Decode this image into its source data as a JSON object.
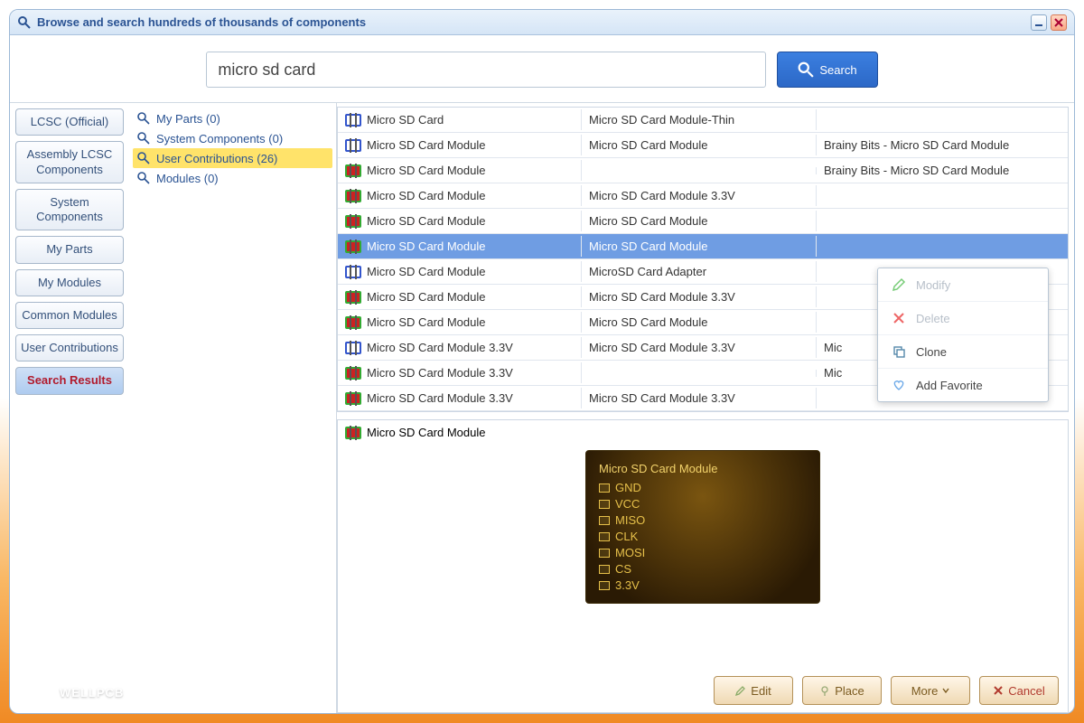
{
  "window": {
    "title": "Browse and search hundreds of thousands of components"
  },
  "search": {
    "value": "micro sd card",
    "button": "Search"
  },
  "nav": {
    "items": [
      "LCSC (Official)",
      "Assembly LCSC Components",
      "System Components",
      "My Parts",
      "My Modules",
      "Common Modules",
      "User Contributions",
      "Search Results"
    ],
    "activeIndex": 7
  },
  "tree": {
    "items": [
      {
        "label": "My Parts (0)"
      },
      {
        "label": "System Components (0)"
      },
      {
        "label": "User Contributions (26)"
      },
      {
        "label": "Modules (0)"
      }
    ],
    "selectedIndex": 2
  },
  "table": {
    "rows": [
      {
        "icon": "blue",
        "c1": "Micro SD Card",
        "c2": "Micro SD Card Module-Thin",
        "c3": ""
      },
      {
        "icon": "blue",
        "c1": "Micro SD Card Module",
        "c2": "Micro SD Card Module",
        "c3": "Brainy Bits - Micro SD Card Module"
      },
      {
        "icon": "green",
        "c1": "Micro SD Card Module",
        "c2": "",
        "c3": "Brainy Bits - Micro SD Card Module"
      },
      {
        "icon": "green",
        "c1": "Micro SD Card Module",
        "c2": "Micro SD Card Module 3.3V",
        "c3": ""
      },
      {
        "icon": "green",
        "c1": "Micro SD Card Module",
        "c2": "Micro SD Card Module",
        "c3": ""
      },
      {
        "icon": "green",
        "c1": "Micro SD Card Module",
        "c2": "Micro SD Card Module",
        "c3": ""
      },
      {
        "icon": "blue",
        "c1": "Micro SD Card Module",
        "c2": "MicroSD Card Adapter",
        "c3": ""
      },
      {
        "icon": "green",
        "c1": "Micro SD Card Module",
        "c2": "Micro SD Card Module 3.3V",
        "c3": ""
      },
      {
        "icon": "green",
        "c1": "Micro SD Card Module",
        "c2": "Micro SD Card Module",
        "c3": ""
      },
      {
        "icon": "blue",
        "c1": "Micro SD Card Module 3.3V",
        "c2": "Micro SD Card Module 3.3V",
        "c3": "Mic"
      },
      {
        "icon": "green",
        "c1": "Micro SD Card Module 3.3V",
        "c2": "",
        "c3": "Mic"
      },
      {
        "icon": "green",
        "c1": "Micro SD Card Module 3.3V",
        "c2": "Micro SD Card Module 3.3V",
        "c3": ""
      }
    ],
    "selectedIndex": 5
  },
  "contextMenu": {
    "items": [
      {
        "label": "Modify",
        "icon": "pencil",
        "disabled": true
      },
      {
        "label": "Delete",
        "icon": "x",
        "disabled": true
      },
      {
        "label": "Clone",
        "icon": "copy",
        "disabled": false
      },
      {
        "label": "Add Favorite",
        "icon": "heart",
        "disabled": false
      }
    ]
  },
  "preview": {
    "title": "Micro SD Card Module",
    "footprint": {
      "title": "Micro SD Card Module",
      "pins": [
        "GND",
        "VCC",
        "MISO",
        "CLK",
        "MOSI",
        "CS",
        "3.3V"
      ]
    }
  },
  "actions": {
    "edit": "Edit",
    "place": "Place",
    "more": "More",
    "cancel": "Cancel"
  },
  "watermark": "WELLPCB"
}
